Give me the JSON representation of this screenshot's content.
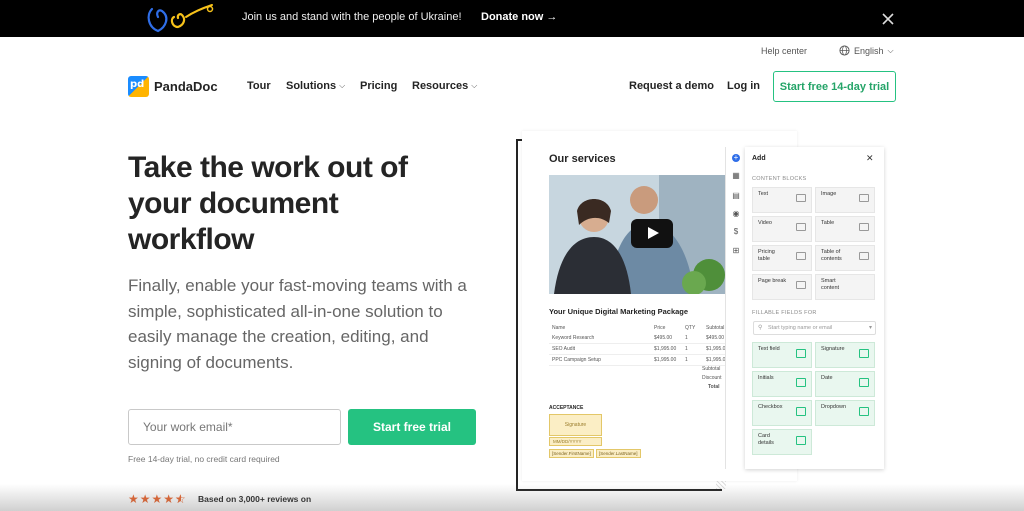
{
  "banner": {
    "message": "Join us and stand with the people of Ukraine!",
    "donate": "Donate now →"
  },
  "topbar": {
    "help": "Help center",
    "language": "English"
  },
  "nav": {
    "brand": "PandaDoc",
    "brand_mark": "pd",
    "items": [
      {
        "label": "Tour",
        "has_dropdown": false
      },
      {
        "label": "Solutions",
        "has_dropdown": true
      },
      {
        "label": "Pricing",
        "has_dropdown": false
      },
      {
        "label": "Resources",
        "has_dropdown": true
      }
    ],
    "request_demo": "Request a demo",
    "login": "Log in",
    "trial": "Start free 14-day trial"
  },
  "hero": {
    "headline": "Take the work out of your document workflow",
    "subheadline": "Finally, enable your fast-moving teams with a simple, sophisticated all-in-one solution to easily manage the creation, editing, and signing of documents.",
    "email_placeholder": "Your work email*",
    "cta": "Start free trial",
    "fine_print": "Free 14-day trial, no credit card required",
    "rating_stars": 4.5,
    "reviews": "Based on 3,000+ reviews on"
  },
  "mockup": {
    "doc_title": "Our services",
    "package_title": "Your Unique Digital Marketing Package",
    "table": {
      "headers": [
        "Name",
        "Price",
        "QTY",
        "Subtotal"
      ],
      "rows": [
        [
          "Keyword Research",
          "$495.00",
          "1",
          "$495.00"
        ],
        [
          "SEO Audit",
          "$1,995.00",
          "1",
          "$1,995.00"
        ],
        [
          "PPC Campaign Setup",
          "$1,995.00",
          "1",
          "$1,995.00"
        ]
      ],
      "summary": [
        "Subtotal",
        "Discount",
        "Total"
      ]
    },
    "acceptance": "ACCEPTANCE",
    "signature": "Signature",
    "date_placeholder": "MM/DD/YYYY",
    "sender_first": "[Sender.FirstName]",
    "sender_last": "[Sender.LastName]",
    "panel": {
      "title": "Add",
      "content_blocks_label": "CONTENT BLOCKS",
      "content_blocks": [
        "Text",
        "Image",
        "Video",
        "Table",
        "Pricing table",
        "Table of contents",
        "Page break",
        "Smart content"
      ],
      "fillable_label": "FILLABLE FIELDS FOR",
      "search_placeholder": "Start typing name or email",
      "fields": [
        "Text field",
        "Signature",
        "Initials",
        "Date",
        "Checkbox",
        "Dropdown",
        "Card details"
      ]
    }
  }
}
